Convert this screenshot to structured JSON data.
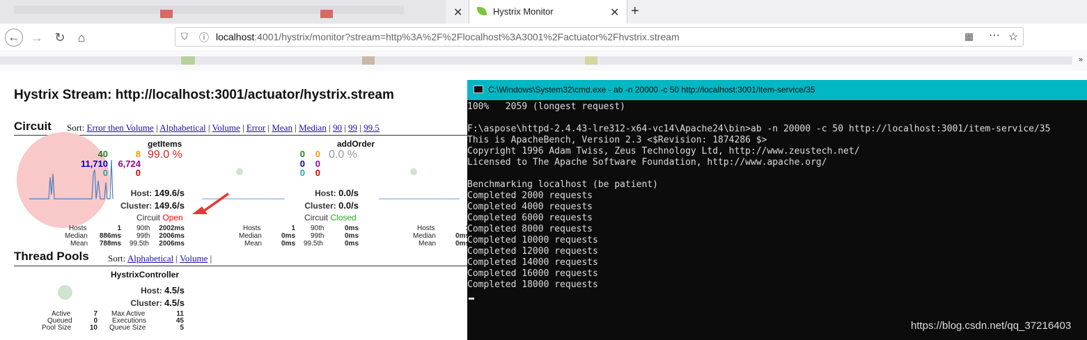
{
  "browser": {
    "active_tab_title": "Hystrix Monitor",
    "url_host": "localhost",
    "url_rest": ":4001/hystrix/monitor?stream=http%3A%2F%2Flocalhost%3A3001%2Factuator%2Fhvstrix.stream"
  },
  "hystrix": {
    "title": "Hystrix Stream: http://localhost:3001/actuator/hystrix.stream",
    "circuit_heading": "Circuit",
    "sort_label": "Sort:",
    "circuit_sort": [
      "Error then Volume",
      "Alphabetical",
      "Volume",
      "Error",
      "Mean",
      "Median",
      "90",
      "99",
      "99.5"
    ],
    "circuits": [
      {
        "name": "getItems",
        "success": "40",
        "short_circuited": "11,710",
        "bad_request": "0",
        "timeout": "8",
        "rejected": "6,724",
        "failure": "0",
        "error_pct": "99.0 %",
        "host_label": "Host:",
        "host_rate": "149.6/s",
        "cluster_label": "Cluster:",
        "cluster_rate": "149.6/s",
        "circuit_label": "Circuit",
        "circuit_status": "Open",
        "hosts": "1",
        "median": "886ms",
        "mean": "788ms",
        "p90": "2002ms",
        "p99": "2006ms",
        "p995": "2006ms",
        "status_color": "#ff0000"
      },
      {
        "name": "addOrder",
        "success": "0",
        "short_circuited": "0",
        "bad_request": "0",
        "timeout": "0",
        "rejected": "0",
        "failure": "0",
        "error_pct": "0.0 %",
        "host_label": "Host:",
        "host_rate": "0.0/s",
        "cluster_label": "Cluster:",
        "cluster_rate": "0.0/s",
        "circuit_label": "Circuit",
        "circuit_status": "Closed",
        "hosts": "1",
        "median": "0ms",
        "mean": "0ms",
        "p90": "0ms",
        "p99": "0ms",
        "p995": "0ms",
        "status_color": "#22aa22"
      },
      {
        "hosts": "1",
        "median": "0ms",
        "mean": "0ms"
      }
    ],
    "stat_labels": {
      "hosts": "Hosts",
      "median": "Median",
      "mean": "Mean",
      "p90": "90th",
      "p99": "99th",
      "p995": "99.5th"
    },
    "thread_heading": "Thread Pools",
    "thread_sort": [
      "Alphabetical",
      "Volume"
    ],
    "pool": {
      "name": "HystrixController",
      "host_label": "Host:",
      "host_rate": "4.5/s",
      "cluster_label": "Cluster:",
      "cluster_rate": "4.5/s",
      "active_label": "Active",
      "active": "7",
      "queued_label": "Queued",
      "queued": "0",
      "pool_size_label": "Pool Size",
      "pool_size": "10",
      "max_active_label": "Max Active",
      "max_active": "11",
      "executions_label": "Executions",
      "executions": "45",
      "queue_size_label": "Queue Size",
      "queue_size": "5"
    },
    "colors": {
      "success": "#2a7a2a",
      "short": "#0000cc",
      "bad": "#22aaaa",
      "timeout": "#ff9900",
      "rejected": "#990099",
      "failure": "#dd0000"
    }
  },
  "cmd": {
    "title": "C:\\Windows\\System32\\cmd.exe - ab  -n 20000 -c 50 http://localhost:3001/item-service/35",
    "lines": [
      "100%   2059 (longest request)",
      "",
      "F:\\aspose\\httpd-2.4.43-lre312-x64-vc14\\Apache24\\bin>ab -n 20000 -c 50 http://localhost:3001/item-service/35",
      "This is ApacheBench, Version 2.3 <$Revision: 1874286 $>",
      "Copyright 1996 Adam Twiss, Zeus Technology Ltd, http://www.zeustech.net/",
      "Licensed to The Apache Software Foundation, http://www.apache.org/",
      "",
      "Benchmarking localhost (be patient)",
      "Completed 2000 requests",
      "Completed 4000 requests",
      "Completed 6000 requests",
      "Completed 8000 requests",
      "Completed 10000 requests",
      "Completed 12000 requests",
      "Completed 14000 requests",
      "Completed 16000 requests",
      "Completed 18000 requests"
    ]
  },
  "watermark": "https://blog.csdn.net/qq_37216403"
}
